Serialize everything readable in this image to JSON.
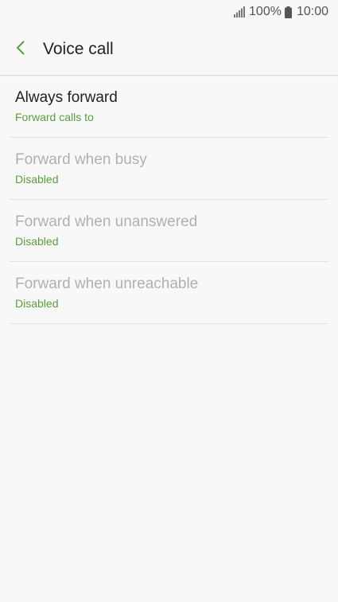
{
  "status_bar": {
    "battery_percent": "100%",
    "time": "10:00",
    "signal_icon": "signal-icon",
    "battery_icon": "battery-icon"
  },
  "header": {
    "back_icon": "chevron-left-icon",
    "title": "Voice call"
  },
  "colors": {
    "accent": "#5a9e3b",
    "title_enabled": "#222222",
    "title_disabled": "#b0b0b0"
  },
  "items": [
    {
      "title": "Always forward",
      "subtitle": "Forward calls to",
      "enabled": true
    },
    {
      "title": "Forward when busy",
      "subtitle": "Disabled",
      "enabled": false
    },
    {
      "title": "Forward when unanswered",
      "subtitle": "Disabled",
      "enabled": false
    },
    {
      "title": "Forward when unreachable",
      "subtitle": "Disabled",
      "enabled": false
    }
  ]
}
